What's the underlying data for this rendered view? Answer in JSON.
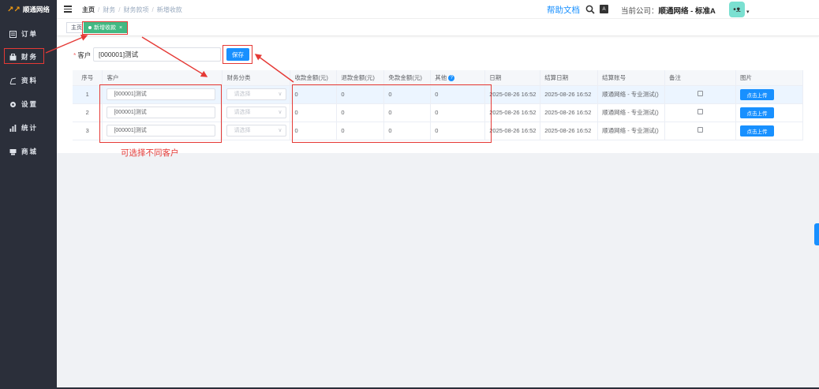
{
  "sidebar": {
    "logo_mark": "↗↗",
    "logo_text": "顺通网络",
    "items": [
      {
        "label": "订单",
        "icon": "order-icon"
      },
      {
        "label": "财务",
        "icon": "finance-icon"
      },
      {
        "label": "资料",
        "icon": "data-icon"
      },
      {
        "label": "设置",
        "icon": "gear-icon"
      },
      {
        "label": "统计",
        "icon": "chart-icon"
      },
      {
        "label": "商城",
        "icon": "shop-icon"
      }
    ]
  },
  "header": {
    "breadcrumb": [
      "主页",
      "财务",
      "财务款项",
      "新增收款"
    ],
    "help_label": "帮助文档",
    "font_icon_text": "A",
    "company_prefix": "当前公司：",
    "company_name": "顺通网络 - 标准A",
    "avatar_glyph": "•ᴥ",
    "caret": "▾"
  },
  "tags": {
    "home": "主页",
    "active": "新增收款",
    "close": "×"
  },
  "form": {
    "customer_label": "客户",
    "required_mark": "*",
    "customer_value": "[000001]测试",
    "save_label": "保存"
  },
  "table": {
    "columns": [
      "序号",
      "客户",
      "财务分类",
      "收款金额(元)",
      "退款金额(元)",
      "免款金额(元)",
      "其他",
      "日期",
      "结算日期",
      "结算账号",
      "备注",
      "图片"
    ],
    "help_glyph": "?",
    "select_placeholder": "请选择",
    "select_arrow": "∨",
    "upload_label": "点击上传",
    "rows": [
      {
        "no": "1",
        "customer": "[000001]测试",
        "receipt": "0",
        "refund": "0",
        "waived": "0",
        "other": "0",
        "date": "2025-08-26 16:52",
        "settle_date": "2025-08-26 16:52",
        "account": "顺通网络 - 专业测试()"
      },
      {
        "no": "2",
        "customer": "[000001]测试",
        "receipt": "0",
        "refund": "0",
        "waived": "0",
        "other": "0",
        "date": "2025-08-26 16:52",
        "settle_date": "2025-08-26 16:52",
        "account": "顺通网络 - 专业测试()"
      },
      {
        "no": "3",
        "customer": "[000001]测试",
        "receipt": "0",
        "refund": "0",
        "waived": "0",
        "other": "0",
        "date": "2025-08-26 16:52",
        "settle_date": "2025-08-26 16:52",
        "account": "顺通网络 - 专业测试()"
      }
    ]
  },
  "annotation": {
    "note": "可选择不同客户",
    "color": "#e53935"
  },
  "colors": {
    "primary": "#1890ff",
    "tag_active": "#42b983",
    "sidebar_bg": "#2b2f3a"
  }
}
